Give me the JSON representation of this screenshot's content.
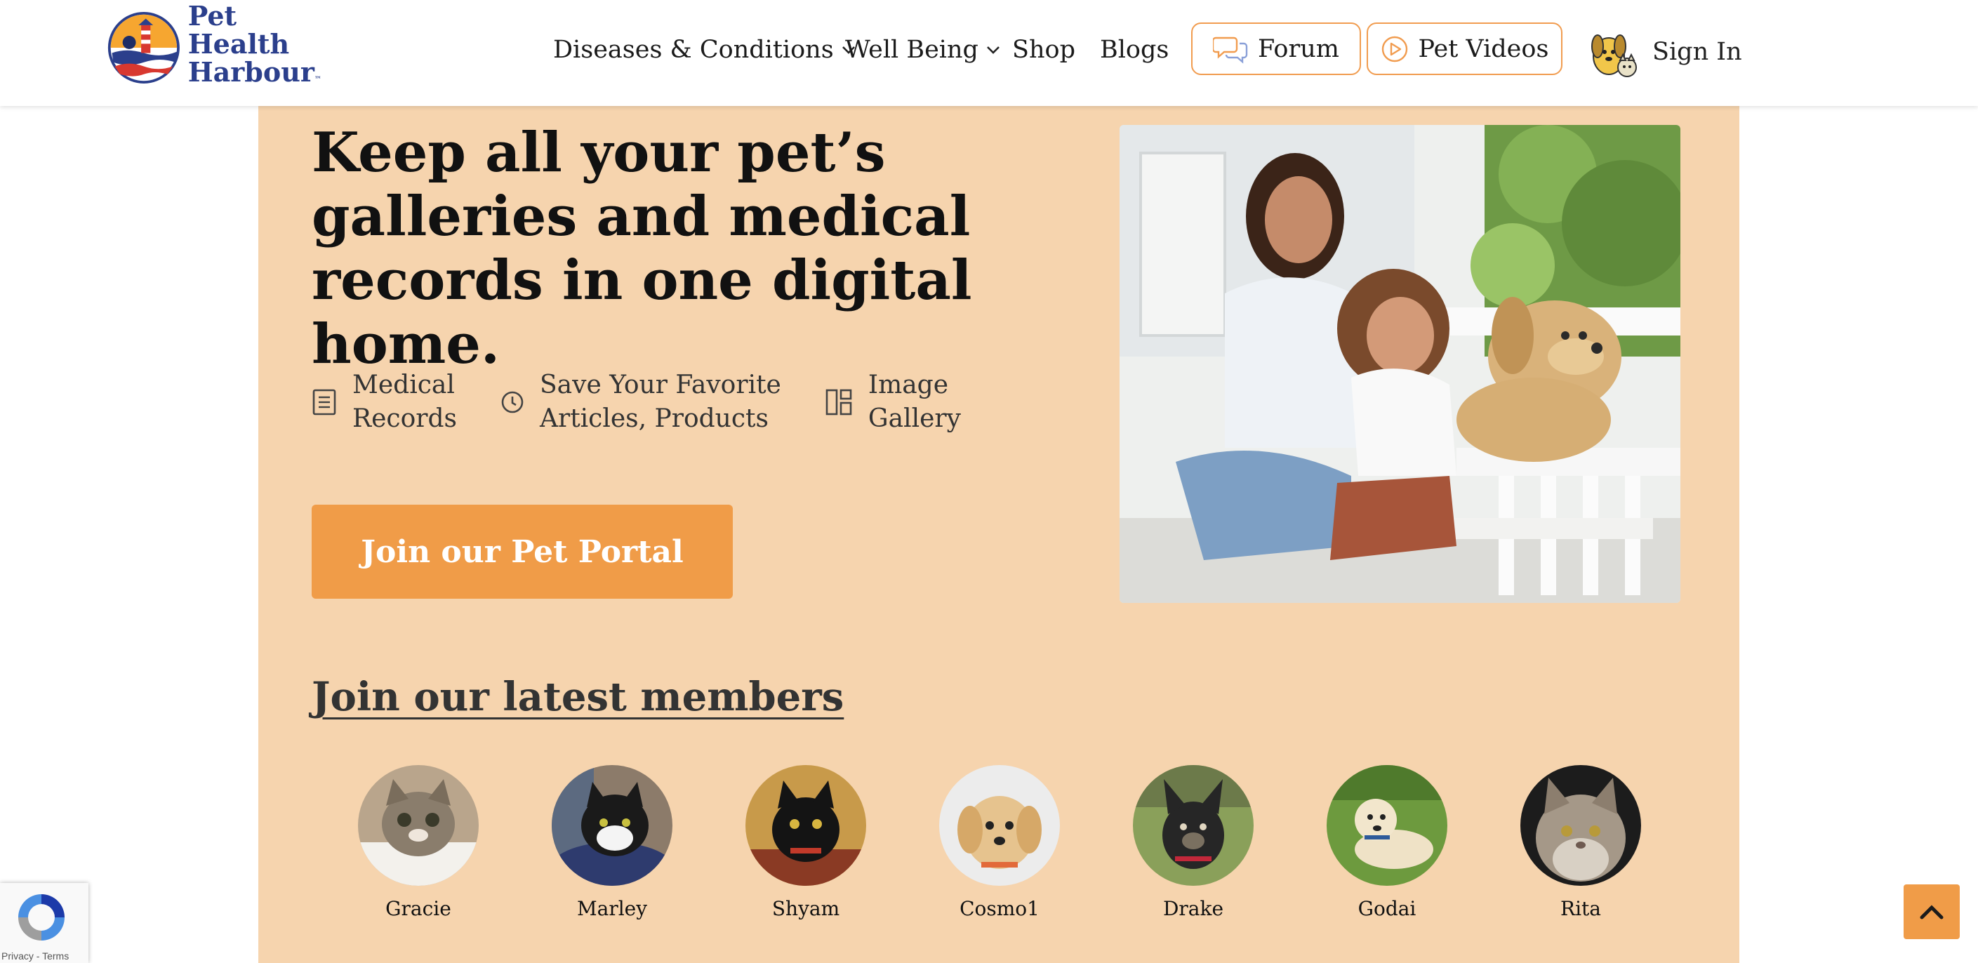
{
  "brand": {
    "line1": "Pet Health",
    "line2": "Harbour",
    "trademark": "™"
  },
  "nav": {
    "items": [
      {
        "label": "Diseases & Conditions",
        "has_dropdown": true
      },
      {
        "label": "Well Being",
        "has_dropdown": true
      },
      {
        "label": "Shop"
      },
      {
        "label": "Blogs"
      }
    ],
    "forum_label": "Forum",
    "videos_label": "Pet Videos",
    "signin_label": "Sign In"
  },
  "hero": {
    "title": "Keep all your pet’s galleries and medical records in one digital home.",
    "features": [
      {
        "icon": "document-list-icon",
        "line1": "Medical",
        "line2": "Records"
      },
      {
        "icon": "clock-icon",
        "line1": "Save Your Favorite",
        "line2": "Articles, Products"
      },
      {
        "icon": "gallery-grid-icon",
        "line1": "Image",
        "line2": "Gallery"
      }
    ],
    "cta_label": "Join our Pet Portal"
  },
  "members": {
    "title": "Join our latest members",
    "list": [
      {
        "name": "Gracie"
      },
      {
        "name": "Marley"
      },
      {
        "name": "Shyam"
      },
      {
        "name": "Cosmo1"
      },
      {
        "name": "Drake"
      },
      {
        "name": "Godai"
      },
      {
        "name": "Rita"
      }
    ]
  },
  "recaptcha": {
    "text": "Privacy - Terms"
  },
  "colors": {
    "accent": "#f09c48",
    "panel": "#f6d4ae",
    "brand_blue": "#2b3f8c",
    "brand_red": "#d8382f"
  }
}
